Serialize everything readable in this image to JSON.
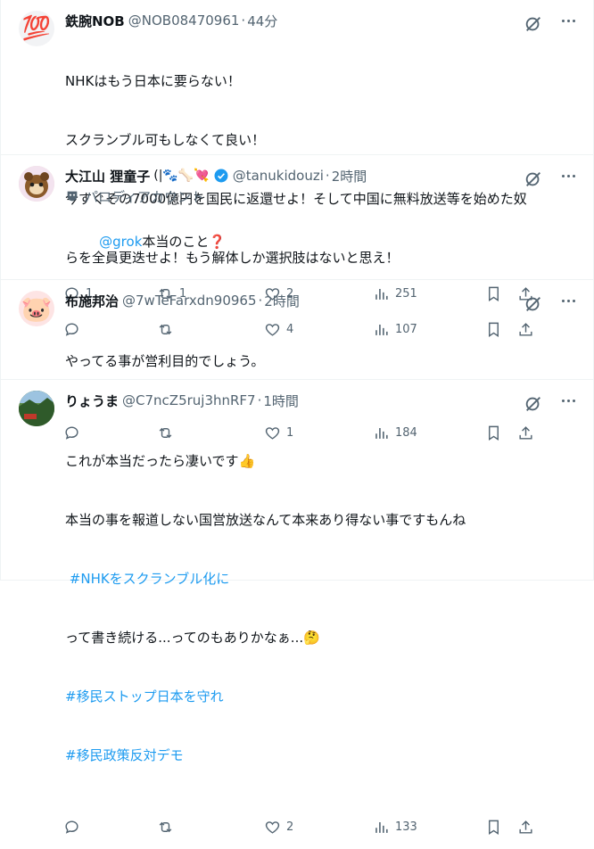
{
  "tweets": [
    {
      "name": "鉄腕NOB",
      "handle": "@NOB08470961",
      "time": "44分",
      "avatar_emoji": "💯",
      "lines": [
        "NHKはもう日本に要らない！",
        "スクランブル可もしなくて良い！",
        "今すぐその7000億円を国民に返還せよ！そして中国に無料放送等を始めた奴",
        "らを全員更迭せよ！もう解体しか選択肢はないと思え！"
      ],
      "replies": "",
      "retweets": "",
      "likes": "4",
      "views": "107"
    },
    {
      "name": "大江山 狸童子",
      "name_suffix": "(|🐾🦴💘",
      "handle": "@tanukidouzi",
      "time": "2時間",
      "parody_label": "パロディアカウント",
      "mention": "@grok",
      "text_after_mention": "本当のこと❓",
      "replies": "1",
      "retweets": "1",
      "likes": "2",
      "views": "251"
    },
    {
      "name": "布施邦治",
      "handle": "@7wTeFarxdn90965",
      "time": "2時間",
      "avatar_emoji": "🐷",
      "lines": [
        "やってる事が営利目的でしょう。"
      ],
      "replies": "",
      "retweets": "",
      "likes": "1",
      "views": "184"
    },
    {
      "name": "りょうま",
      "handle": "@C7ncZ5ruj3hnRF7",
      "time": "1時間",
      "line1": "これが本当だったら凄いです👍",
      "line2": "本当の事を報道しない国営放送なんて本来あり得ない事ですもんね",
      "hashtag1": " #NHKをスクランブル化に",
      "line4": "って書き続ける...ってのもありかなぁ...🤔",
      "hashtag2": "#移民ストップ日本を守れ",
      "hashtag3": "#移民政策反対デモ",
      "replies": "",
      "retweets": "",
      "likes": "2",
      "views": "133"
    }
  ],
  "colors": {
    "accent": "#1d9bf0",
    "muted": "#536471",
    "verified": "#1d9bf0"
  }
}
